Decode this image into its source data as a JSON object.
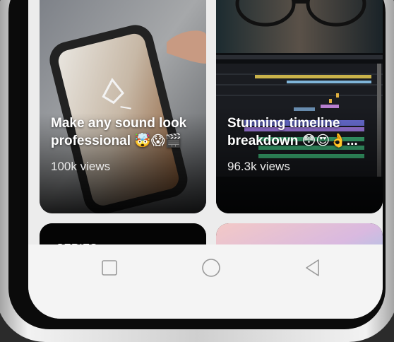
{
  "feed": {
    "cards": [
      {
        "title": "Make any sound look\nprofessional 🤯😱🎬",
        "views": "100k views"
      },
      {
        "title": "Stunning timeline\nbreakdown 😳😍👌...",
        "views": "96.3k views"
      },
      {
        "badge": "SERIES"
      },
      {}
    ]
  },
  "navbar": {
    "recents": "recents-square-icon",
    "home": "home-circle-icon",
    "back": "back-triangle-icon"
  },
  "colors": {
    "card_bg": "#000000",
    "screen_bg": "#ececec",
    "navbar_bg": "#f4f4f4",
    "title_text": "#ffffff"
  }
}
